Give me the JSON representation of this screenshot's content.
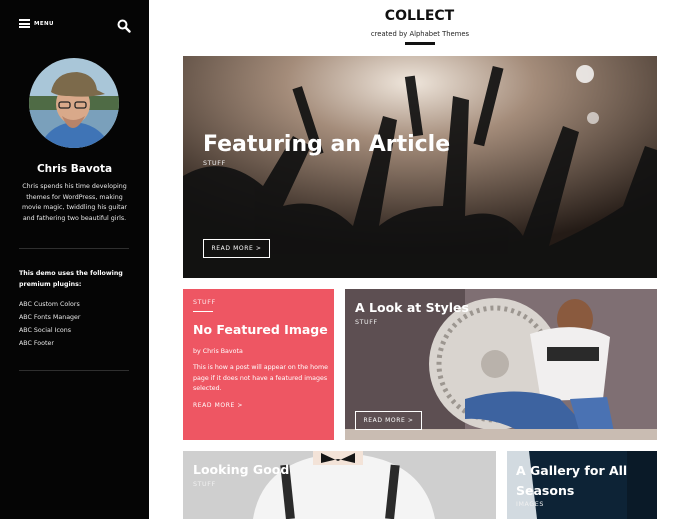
{
  "sidebar": {
    "menu_label": "MENU",
    "author": {
      "name": "Chris Bavota",
      "bio": "Chris spends his time developing themes for WordPress, making movie magic, twiddling his guitar and fathering two beautiful girls."
    },
    "plugins_intro": "This demo uses the following premium plugins:",
    "plugins": [
      "ABC Custom Colors",
      "ABC Fonts Manager",
      "ABC Social Icons",
      "ABC Footer"
    ]
  },
  "header": {
    "site_title": "COLLECT",
    "tagline": "created by Alphabet Themes"
  },
  "posts": [
    {
      "title": "Featuring an Article",
      "category": "STUFF",
      "read_more": "READ MORE >"
    },
    {
      "title": "No Featured Image",
      "category": "STUFF",
      "byline": "by Chris Bavota",
      "excerpt": "This is how a post will appear on the home page if it does not have a featured images selected.",
      "read_more": "READ MORE >",
      "background": "#ee5663"
    },
    {
      "title": "A Look at Styles",
      "category": "STUFF",
      "read_more": "READ MORE >"
    },
    {
      "title": "Looking Good",
      "category": "STUFF"
    },
    {
      "title": "A Gallery for All Seasons",
      "category": "IMAGES"
    }
  ],
  "colors": {
    "sidebar_bg": "#050505",
    "accent": "#ee5663",
    "text_dark": "#111111"
  }
}
